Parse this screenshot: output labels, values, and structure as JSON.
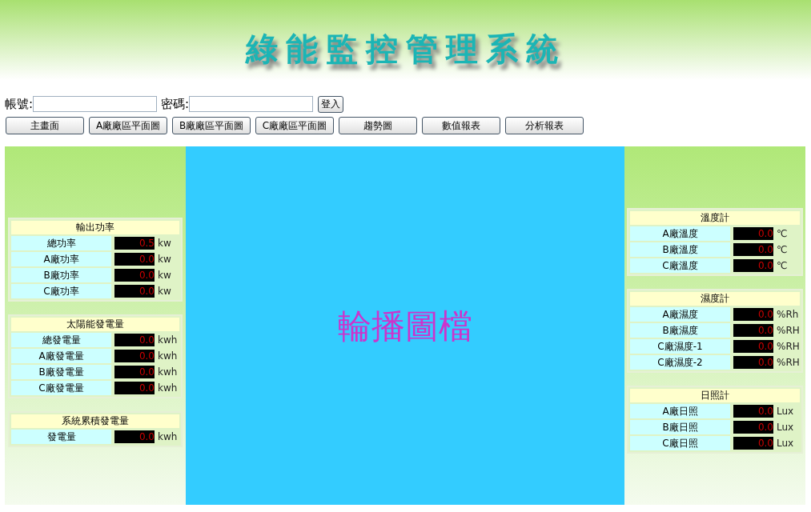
{
  "header": {
    "title": "綠能監控管理系統"
  },
  "login": {
    "account_label": "帳號:",
    "password_label": "密碼:",
    "submit": "登入"
  },
  "nav": [
    "主畫面",
    "A廠廠區平面圖",
    "B廠廠區平面圖",
    "C廠廠區平面圖",
    "趨勢圖",
    "數值報表",
    "分析報表"
  ],
  "left_panels": [
    {
      "title": "輸出功率",
      "rows": [
        {
          "label": "總功率",
          "value": "0.5",
          "unit": "kw"
        },
        {
          "label": "A廠功率",
          "value": "0.0",
          "unit": "kw"
        },
        {
          "label": "B廠功率",
          "value": "0.0",
          "unit": "kw"
        },
        {
          "label": "C廠功率",
          "value": "0.0",
          "unit": "kw"
        }
      ]
    },
    {
      "title": "太陽能發電量",
      "rows": [
        {
          "label": "總發電量",
          "value": "0.0",
          "unit": "kwh"
        },
        {
          "label": "A廠發電量",
          "value": "0.0",
          "unit": "kwh"
        },
        {
          "label": "B廠發電量",
          "value": "0.0",
          "unit": "kwh"
        },
        {
          "label": "C廠發電量",
          "value": "0.0",
          "unit": "kwh"
        }
      ]
    },
    {
      "title": "系統累積發電量",
      "rows": [
        {
          "label": "發電量",
          "value": "0.0",
          "unit": "kwh"
        }
      ]
    }
  ],
  "carousel": {
    "text": "輪播圖檔"
  },
  "right_panels": [
    {
      "title": "溫度計",
      "rows": [
        {
          "label": "A廠溫度",
          "value": "0.0",
          "unit": "℃"
        },
        {
          "label": "B廠溫度",
          "value": "0.0",
          "unit": "℃"
        },
        {
          "label": "C廠溫度",
          "value": "0.0",
          "unit": "℃"
        }
      ]
    },
    {
      "title": "濕度計",
      "rows": [
        {
          "label": "A廠濕度",
          "value": "0.0",
          "unit": "%Rh"
        },
        {
          "label": "B廠濕度",
          "value": "0.0",
          "unit": "%RH"
        },
        {
          "label": "C廠濕度-1",
          "value": "0.0",
          "unit": "%RH"
        },
        {
          "label": "C廠濕度-2",
          "value": "0.0",
          "unit": "%RH"
        }
      ]
    },
    {
      "title": "日照計",
      "rows": [
        {
          "label": "A廠日照",
          "value": "0.0",
          "unit": "Lux"
        },
        {
          "label": "B廠日照",
          "value": "0.0",
          "unit": "Lux"
        },
        {
          "label": "C廠日照",
          "value": "0.0",
          "unit": "Lux"
        }
      ]
    }
  ]
}
